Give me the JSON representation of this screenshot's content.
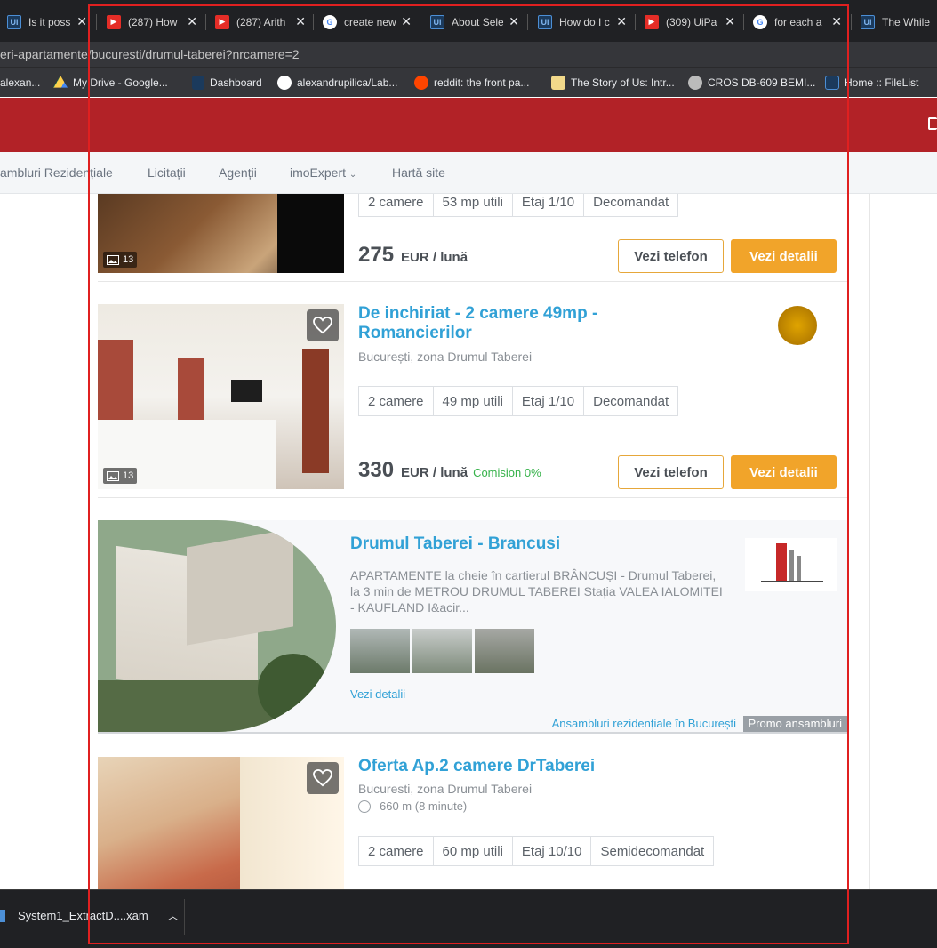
{
  "tabs": [
    {
      "title": "Is it possib",
      "icon": "uipath-icon"
    },
    {
      "title": "(287) How",
      "icon": "youtube-icon"
    },
    {
      "title": "(287) Arith",
      "icon": "youtube-icon"
    },
    {
      "title": "create new",
      "icon": "google-icon"
    },
    {
      "title": "About Sele",
      "icon": "uipath-icon"
    },
    {
      "title": "How do I c",
      "icon": "uipath-icon"
    },
    {
      "title": "(309) UiPa",
      "icon": "youtube-icon"
    },
    {
      "title": "for each a",
      "icon": "google-icon"
    },
    {
      "title": "The While",
      "icon": "uipath-icon"
    }
  ],
  "address": "eri-apartamente/bucuresti/drumul-taberei?nrcamere=2",
  "bookmarks": [
    {
      "label": "alexan...",
      "icon": "bookmark-icon"
    },
    {
      "label": "My Drive - Google...",
      "icon": "drive-icon"
    },
    {
      "label": "Dashboard",
      "icon": "uipath-icon"
    },
    {
      "label": "alexandrupilica/Lab...",
      "icon": "github-icon"
    },
    {
      "label": "reddit: the front pa...",
      "icon": "reddit-icon"
    },
    {
      "label": "The Story of Us: Intr...",
      "icon": "book-icon"
    },
    {
      "label": "CROS DB-609 BEMI...",
      "icon": "globe-icon"
    },
    {
      "label": "Home :: FileList",
      "icon": "filelist-icon"
    }
  ],
  "nav": [
    "ambluri Rezidențiale",
    "Licitații",
    "Agenții",
    "imoExpert",
    "Hartă site"
  ],
  "listing1": {
    "chips": [
      "2 camere",
      "53 mp utili",
      "Etaj 1/10",
      "Decomandat"
    ],
    "price": "275",
    "currency": "EUR / lună",
    "photos": "13",
    "phone_btn": "Vezi telefon",
    "details_btn": "Vezi detalii"
  },
  "listing2": {
    "title_line1": "De inchiriat - 2 camere 49mp -",
    "title_line2": "Romancierilor",
    "location": "București, zona Drumul Taberei",
    "chips": [
      "2 camere",
      "49 mp utili",
      "Etaj 1/10",
      "Decomandat"
    ],
    "price": "330",
    "currency": "EUR / lună",
    "commission": "Comision 0%",
    "photos": "13",
    "phone_btn": "Vezi telefon",
    "details_btn": "Vezi detalii"
  },
  "promo": {
    "title": "Drumul Taberei - Brancusi",
    "desc": "APARTAMENTE la cheie în cartierul BRÂNCUȘI - Drumul Taberei, la 3 min de METROU DRUMUL TABEREI Stația VALEA IALOMITEI - KAUFLAND I&acir...",
    "link": "Vezi detalii",
    "footer_link": "Ansambluri rezidențiale în București",
    "footer_tag": "Promo ansambluri"
  },
  "listing3": {
    "title": "Oferta Ap.2 camere DrTaberei",
    "location": "Bucuresti, zona Drumul Taberei",
    "distance": "660 m (8 minute)",
    "chips": [
      "2 camere",
      "60 mp utili",
      "Etaj 10/10",
      "Semidecomandat"
    ]
  },
  "downloads": {
    "file": "System1_ExtractD....xam"
  },
  "colors": {
    "brand_red": "#b22227",
    "link_blue": "#31a1d6",
    "accent_orange": "#f1a42a",
    "commission_green": "#36b24a",
    "highlight_red": "#e02020"
  }
}
